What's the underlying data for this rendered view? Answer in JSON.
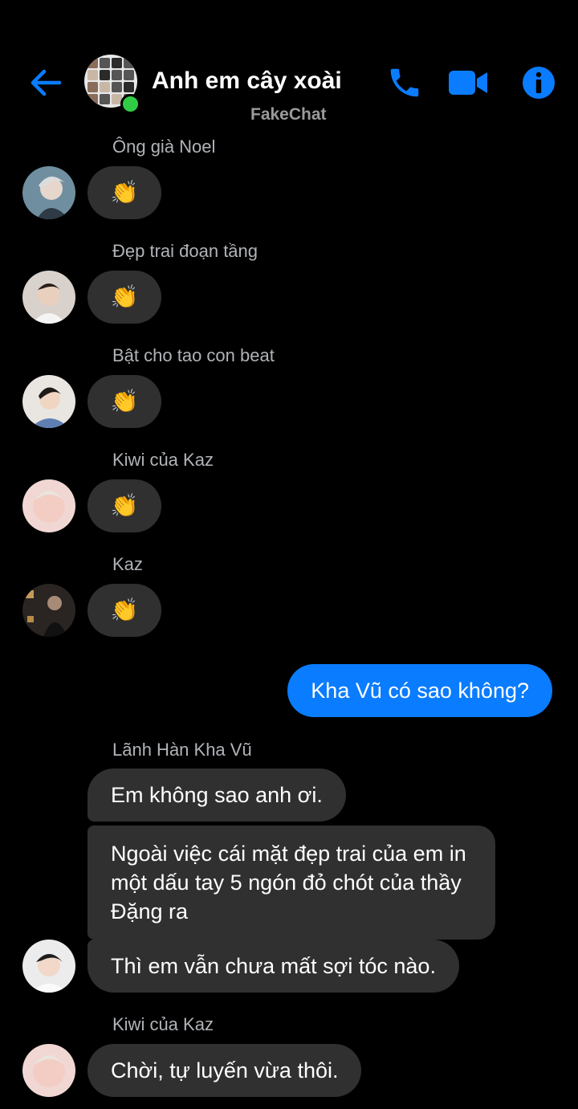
{
  "header": {
    "title": "Anh em cây xoài",
    "watermark": "FakeChat",
    "colors": {
      "accent": "#0a7cff",
      "online": "#31cc46",
      "background": "#000000"
    },
    "icons": [
      "back-arrow-icon",
      "phone-icon",
      "video-camera-icon",
      "info-icon"
    ]
  },
  "messages": [
    {
      "sender": "Ông già Noel",
      "text": "👏"
    },
    {
      "sender": "Đẹp trai đoạn tầng",
      "text": "👏"
    },
    {
      "sender": "Bật cho tao con beat",
      "text": "👏"
    },
    {
      "sender": "Kiwi của Kaz",
      "text": "👏"
    },
    {
      "sender": "Kaz",
      "text": "👏"
    },
    {
      "sender": "",
      "text": "Kha Vũ có sao không?"
    },
    {
      "sender": "Lãnh Hàn Kha Vũ",
      "text": "Em không sao anh ơi."
    },
    {
      "sender": "",
      "text": "Ngoài việc cái mặt đẹp trai của em in một dấu tay 5 ngón đỏ chót của thầy Đặng ra"
    },
    {
      "sender": "",
      "text": "Thì em vẫn chưa mất sợi tóc nào."
    },
    {
      "sender": "Kiwi của Kaz",
      "text": "Chời, tự luyến vừa thôi."
    }
  ]
}
